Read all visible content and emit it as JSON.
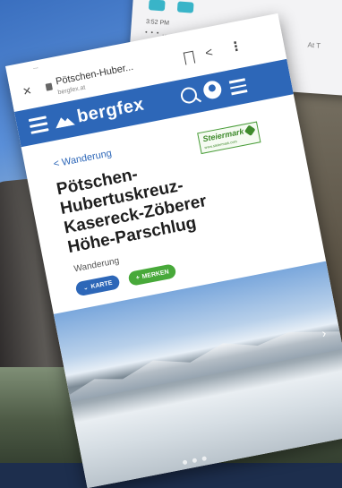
{
  "back_card": {
    "time": "3:52 PM",
    "status": "• • • ...",
    "at_label": "At T"
  },
  "phone": {
    "status_bar": "...",
    "browser": {
      "close_glyph": "×",
      "tab_title": "Pötschen-Huber...",
      "tab_url": "bergfex.at",
      "share_glyph": "<",
      "more_glyph": "⋮"
    },
    "site": {
      "logo_text": "bergfex"
    },
    "content": {
      "back_link": "< Wanderung",
      "sponsor_name": "Steiermark",
      "sponsor_url": "www.steiermark.com",
      "title": "Pötschen-Hubertuskreuz-Kasereck-Zöberer Höhe-Parschlug",
      "subtitle": "Wanderung",
      "btn_karte": "KARTE",
      "btn_merken": "MERKEN"
    },
    "hero_arrow": "›"
  },
  "colors": {
    "brand_blue": "#2d67b8",
    "merken_green": "#48a93a",
    "sponsor_green": "#3e8a2c"
  }
}
